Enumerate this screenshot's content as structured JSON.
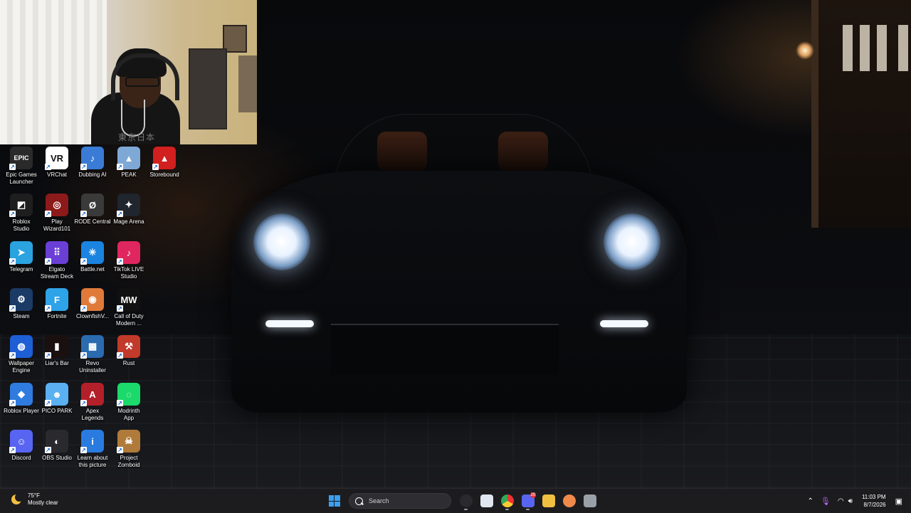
{
  "webcam": {
    "overlay_text": "東京日本"
  },
  "desktop_icons": [
    {
      "label": "Epic Games\nLauncher",
      "icon": "epic-games-icon",
      "glyph": "EPIC",
      "color": "#2a2a2a"
    },
    {
      "label": "VRChat",
      "icon": "vrchat-icon",
      "glyph": "VR",
      "color": "#ffffff"
    },
    {
      "label": "Dubbing AI",
      "icon": "dubbing-ai-icon",
      "glyph": "♪",
      "color": "#3a7bd5"
    },
    {
      "label": "PEAK",
      "icon": "peak-icon",
      "glyph": "▲",
      "color": "#7ea9d6"
    },
    {
      "label": "Storebound",
      "icon": "storebound-icon",
      "glyph": "▲",
      "color": "#d21f1f"
    },
    {
      "label": "Roblox\nStudio",
      "icon": "roblox-studio-icon",
      "glyph": "◩",
      "color": "#1e1e1e"
    },
    {
      "label": "Play\nWizard101",
      "icon": "wizard101-icon",
      "glyph": "◎",
      "color": "#8c1a1a"
    },
    {
      "label": "RODE Central",
      "icon": "rode-central-icon",
      "glyph": "Ø",
      "color": "#3a3a3a"
    },
    {
      "label": "Mage Arena",
      "icon": "mage-arena-icon",
      "glyph": "✦",
      "color": "#20252e"
    },
    {
      "label": "Telegram",
      "icon": "telegram-icon",
      "glyph": "➤",
      "color": "#2aa3e0"
    },
    {
      "label": "Elgato\nStream Deck",
      "icon": "stream-deck-icon",
      "glyph": "⠿",
      "color": "#6a3fd6"
    },
    {
      "label": "Battle.net",
      "icon": "battlenet-icon",
      "glyph": "✳",
      "color": "#1a84e0"
    },
    {
      "label": "TikTok LIVE\nStudio",
      "icon": "tiktok-icon",
      "glyph": "♪",
      "color": "#e0265f"
    },
    {
      "label": "Steam",
      "icon": "steam-icon",
      "glyph": "⚙",
      "color": "#1b3b66"
    },
    {
      "label": "Fortnite",
      "icon": "fortnite-icon",
      "glyph": "F",
      "color": "#2ea3e8"
    },
    {
      "label": "ClownfishV...",
      "icon": "clownfish-icon",
      "glyph": "◉",
      "color": "#e07a3a"
    },
    {
      "label": "Call of Duty\nModern ...",
      "icon": "call-of-duty-icon",
      "glyph": "MW",
      "color": "#111111"
    },
    {
      "label": "Wallpaper\nEngine",
      "icon": "wallpaper-engine-icon",
      "glyph": "◍",
      "color": "#1e5fd6"
    },
    {
      "label": "Liar's Bar",
      "icon": "liars-bar-icon",
      "glyph": "▮",
      "color": "#1a1010"
    },
    {
      "label": "Revo\nUninstaller",
      "icon": "revo-uninstaller-icon",
      "glyph": "▦",
      "color": "#2b6bb0"
    },
    {
      "label": "Rust",
      "icon": "rust-icon",
      "glyph": "⚒",
      "color": "#c23a2a"
    },
    {
      "label": "Roblox Player",
      "icon": "roblox-player-icon",
      "glyph": "◆",
      "color": "#2f7be0"
    },
    {
      "label": "PICO PARK",
      "icon": "pico-park-icon",
      "glyph": "☻",
      "color": "#5ab0f0"
    },
    {
      "label": "Apex\nLegends",
      "icon": "apex-legends-icon",
      "glyph": "A",
      "color": "#b3202a"
    },
    {
      "label": "Modrinth\nApp",
      "icon": "modrinth-icon",
      "glyph": "◌",
      "color": "#1bd96a"
    },
    {
      "label": "Discord",
      "icon": "discord-icon",
      "glyph": "☺",
      "color": "#5865f2"
    },
    {
      "label": "OBS Studio",
      "icon": "obs-studio-icon",
      "glyph": "◐",
      "color": "#2a2a2e"
    },
    {
      "label": "Learn about\nthis picture",
      "icon": "info-picture-icon",
      "glyph": "i",
      "color": "#2a7be0"
    },
    {
      "label": "Project\nZomboid",
      "icon": "project-zomboid-icon",
      "glyph": "☠",
      "color": "#b07a3a"
    }
  ],
  "taskbar": {
    "weather": {
      "temp": "75°F",
      "condition": "Mostly clear"
    },
    "search_placeholder": "Search",
    "apps": [
      {
        "icon": "start-icon"
      },
      {
        "icon": "obs-taskbar-icon",
        "color": "#2a2a2e"
      },
      {
        "icon": "photos-icon",
        "color": "#dfe6ee"
      },
      {
        "icon": "chrome-icon",
        "color": "#e0a020"
      },
      {
        "icon": "discord-taskbar-icon",
        "color": "#5865f2",
        "badge": "20"
      },
      {
        "icon": "file-explorer-icon",
        "color": "#f0c040"
      },
      {
        "icon": "clownfish-taskbar-icon",
        "color": "#f08a4a"
      },
      {
        "icon": "settings-icon",
        "color": "#9aa0a8"
      }
    ],
    "clock": {
      "time": "11:03 PM",
      "date": "8/7/2026"
    }
  }
}
